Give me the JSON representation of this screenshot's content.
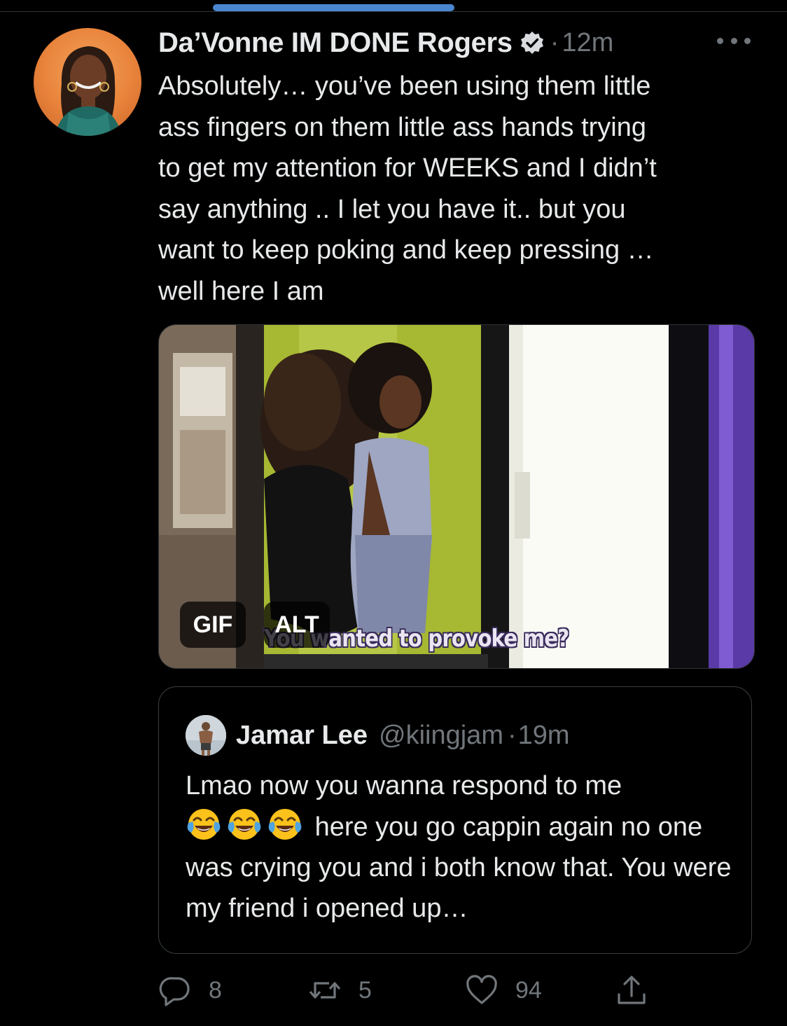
{
  "tweet": {
    "author_name": "Da’Vonne IM DONE Rogers",
    "separator": "·",
    "timestamp": "12m",
    "text": "Absolutely… you’ve been using them little\nass fingers on them little ass hands trying\nto get my attention for WEEKS and I didn’t\nsay anything .. I let you have it.. but you\nwant to keep poking and keep pressing …\nwell here I am"
  },
  "media": {
    "gif_label": "GIF",
    "alt_label": "ALT",
    "caption": "You wanted to provoke me?"
  },
  "quote": {
    "name": "Jamar Lee",
    "handle": "@kiingjam",
    "separator": "·",
    "timestamp": "19m",
    "text_line1": "Lmao now you wanna respond to me",
    "text_rest": "here you go cappin again no one was crying you and i both know that. You were my friend i opened up…"
  },
  "actions": {
    "reply_count": "8",
    "retweet_count": "5",
    "like_count": "94"
  },
  "icons": {
    "verified": "verified-badge-icon",
    "more": "more-dots-icon",
    "reply": "reply-icon",
    "retweet": "retweet-icon",
    "like": "heart-icon",
    "share": "share-icon",
    "emoji": "tears-of-joy-emoji"
  },
  "colors": {
    "background": "#000000",
    "text_primary": "#e7e9ea",
    "text_secondary": "#71767b",
    "border": "#2f3336",
    "scroll_indicator": "#4a86cf"
  }
}
